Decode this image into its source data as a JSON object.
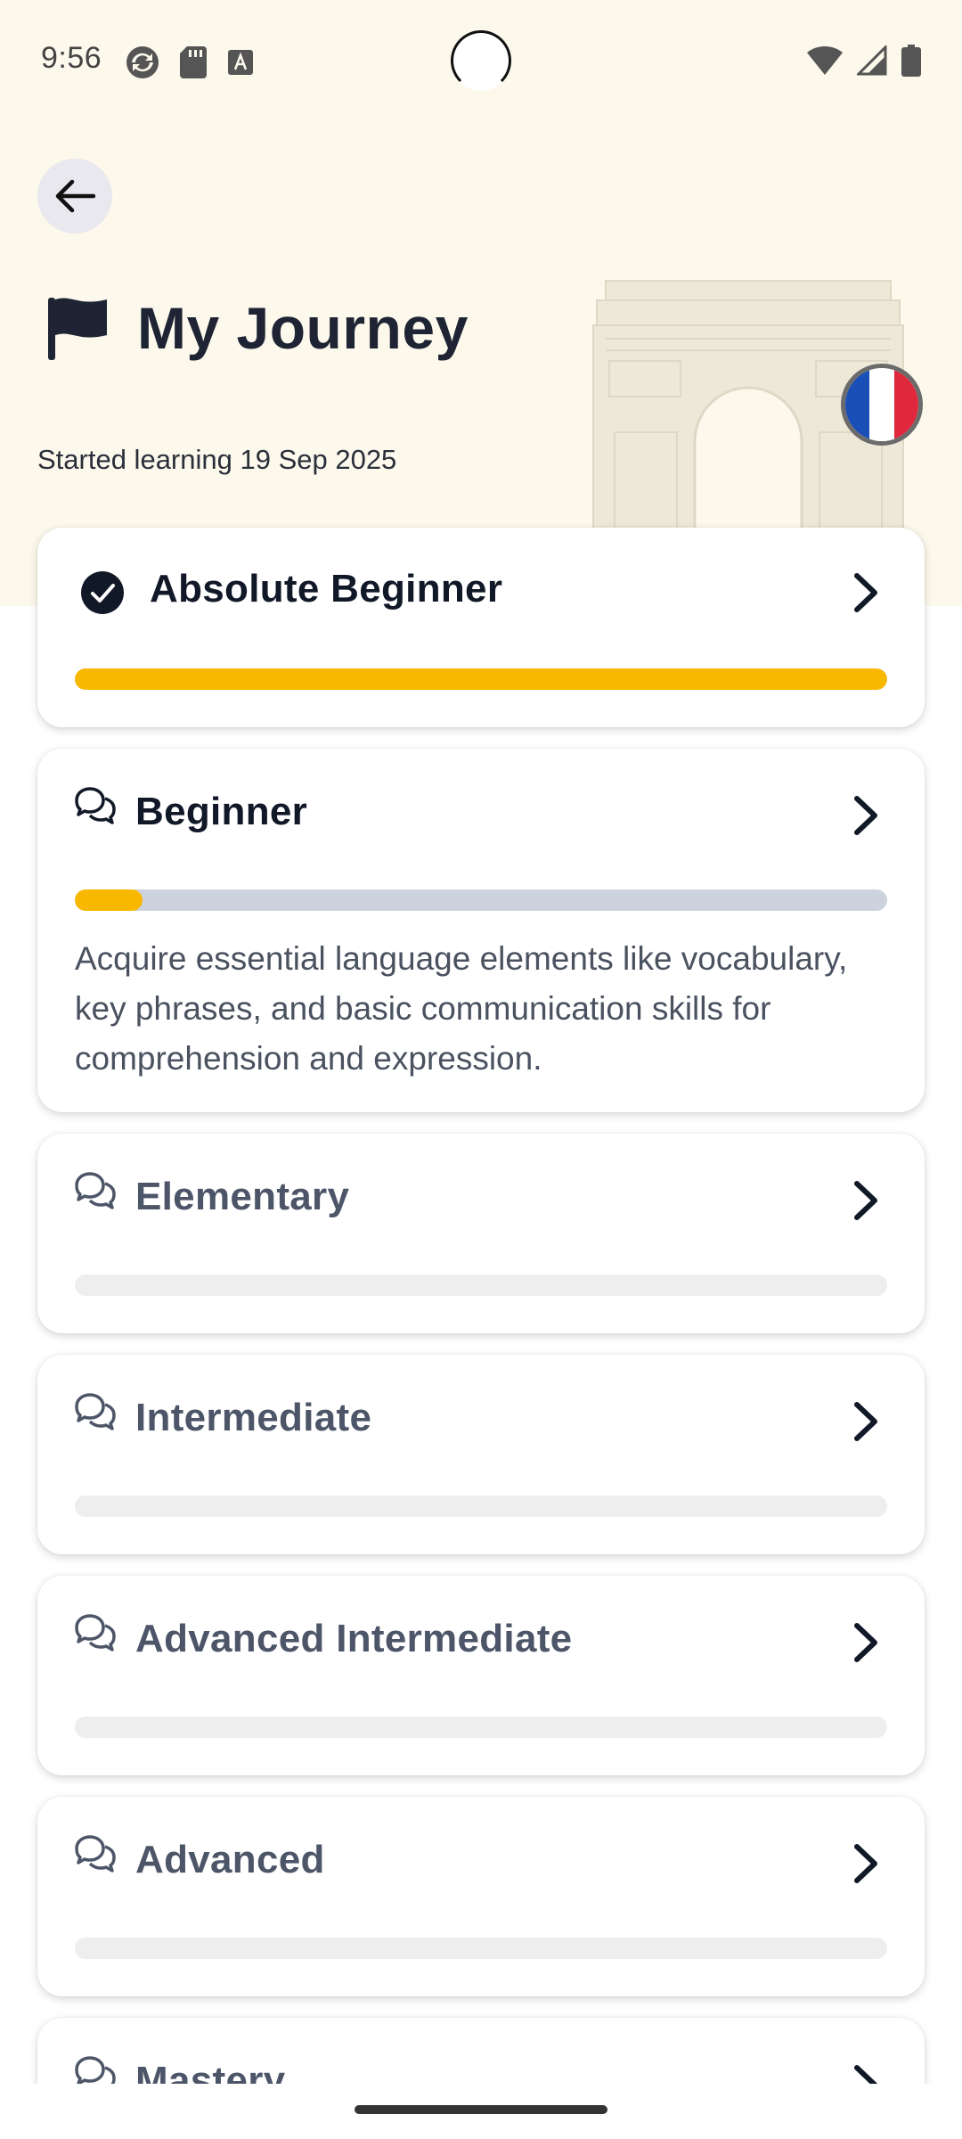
{
  "status_bar": {
    "time": "9:56",
    "left_icons": [
      "sync-icon",
      "sd-card-icon",
      "text-a-icon"
    ],
    "right_icons": [
      "wifi-icon",
      "cell-signal-icon",
      "battery-icon"
    ]
  },
  "header": {
    "back_icon": "arrow-left-icon",
    "title_icon": "flag-icon",
    "title": "My Journey",
    "started": "Started learning 19 Sep 2025",
    "language_flag": {
      "colors": [
        "#1a4fb8",
        "#ffffff",
        "#e0283c"
      ]
    }
  },
  "colors": {
    "accent": "#f9b800",
    "track_active": "#cdd3de",
    "track_locked": "#eeeeee",
    "hero_bg": "#fcf8ec"
  },
  "levels": [
    {
      "name": "Absolute Beginner",
      "icon": "check-circle-icon",
      "state": "done",
      "progress": 1.0
    },
    {
      "name": "Beginner",
      "icon": "chat-bubbles-icon",
      "state": "active",
      "progress": 0.08,
      "description": "Acquire essential language elements like vocabulary, key phrases, and basic communication skills for comprehension and expression."
    },
    {
      "name": "Elementary",
      "icon": "chat-bubbles-icon",
      "state": "locked",
      "progress": 0
    },
    {
      "name": "Intermediate",
      "icon": "chat-bubbles-icon",
      "state": "locked",
      "progress": 0
    },
    {
      "name": "Advanced Intermediate",
      "icon": "chat-bubbles-icon",
      "state": "locked",
      "progress": 0
    },
    {
      "name": "Advanced",
      "icon": "chat-bubbles-icon",
      "state": "locked",
      "progress": 0
    },
    {
      "name": "Mastery",
      "icon": "chat-bubbles-icon",
      "state": "locked",
      "progress": 0
    }
  ]
}
